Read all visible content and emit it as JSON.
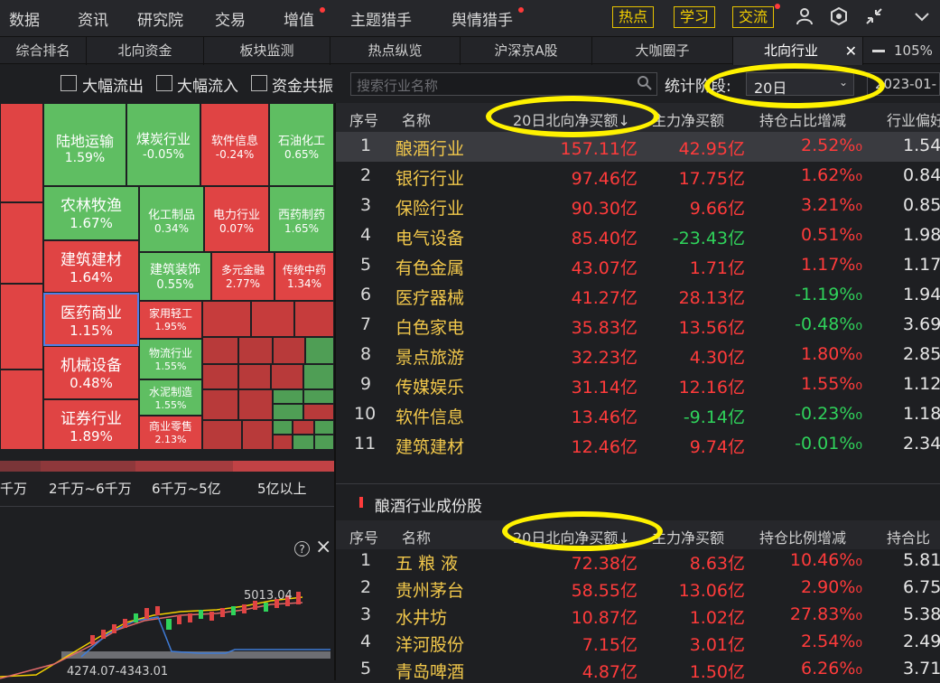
{
  "topnav": {
    "items": [
      "数据",
      "资讯",
      "研究院",
      "交易",
      "增值",
      "主题猎手",
      "舆情猎手"
    ],
    "boxes": [
      "热点",
      "学习",
      "交流"
    ]
  },
  "tabs": [
    "综合排名",
    "北向资金",
    "板块监测",
    "热点纵览",
    "沪深京A股",
    "大咖圈子",
    "北向行业"
  ],
  "zoom": "105%",
  "filters": {
    "checkboxes": [
      "大幅流出",
      "大幅流入",
      "资金共振"
    ],
    "search_placeholder": "搜索行业名称",
    "period_label": "统计阶段:",
    "period_value": "20日",
    "date_value": "2023-01-"
  },
  "treemap": {
    "cells": [
      {
        "name": "陆地运输",
        "pct": "1.59%"
      },
      {
        "name": "煤炭行业",
        "pct": "-0.05%"
      },
      {
        "name": "软件信息",
        "pct": "-0.24%"
      },
      {
        "name": "石油化工",
        "pct": "0.65%"
      },
      {
        "name": "农林牧渔",
        "pct": "1.67%"
      },
      {
        "name": "化工制品",
        "pct": "0.34%"
      },
      {
        "name": "电力行业",
        "pct": "0.07%"
      },
      {
        "name": "西药制药",
        "pct": "1.65%"
      },
      {
        "name": "建筑建材",
        "pct": "1.64%"
      },
      {
        "name": "建筑装饰",
        "pct": "0.55%"
      },
      {
        "name": "多元金融",
        "pct": "2.77%"
      },
      {
        "name": "传统中药",
        "pct": "1.34%"
      },
      {
        "name": "医药商业",
        "pct": "1.15%"
      },
      {
        "name": "家用轻工",
        "pct": "1.95%"
      },
      {
        "name": "机械设备",
        "pct": "0.48%"
      },
      {
        "name": "物流行业",
        "pct": "1.55%"
      },
      {
        "name": "水泥制造",
        "pct": "1.55%"
      },
      {
        "name": "证券行业",
        "pct": "1.89%"
      },
      {
        "name": "商业零售",
        "pct": "2.13%"
      }
    ],
    "legend": [
      "千万",
      "2千万~6千万",
      "6千万~5亿",
      "5亿以上"
    ]
  },
  "mini_chart": {
    "help_icon": "?",
    "close_icon": "×",
    "high_label": "5013.04",
    "range_label": "4274.07-4343.01"
  },
  "industry_table": {
    "headers": [
      "序号",
      "名称",
      "20日北向净买额↓",
      "主力净买额",
      "持仓占比增减",
      "行业偏好"
    ],
    "rows": [
      {
        "idx": "1",
        "name": "酿酒行业",
        "north": "157.11亿",
        "main": "42.95亿",
        "chg": "2.52%₀",
        "pref": "1.54"
      },
      {
        "idx": "2",
        "name": "银行行业",
        "north": "97.46亿",
        "main": "17.75亿",
        "chg": "1.62%₀",
        "pref": "0.84"
      },
      {
        "idx": "3",
        "name": "保险行业",
        "north": "90.30亿",
        "main": "9.66亿",
        "chg": "3.21%₀",
        "pref": "0.85"
      },
      {
        "idx": "4",
        "name": "电气设备",
        "north": "85.40亿",
        "main": "-23.43亿",
        "chg": "0.51%₀",
        "pref": "1.98"
      },
      {
        "idx": "5",
        "name": "有色金属",
        "north": "43.07亿",
        "main": "1.71亿",
        "chg": "1.17%₀",
        "pref": "1.17"
      },
      {
        "idx": "6",
        "name": "医疗器械",
        "north": "41.27亿",
        "main": "28.13亿",
        "chg": "-1.19%₀",
        "pref": "1.94"
      },
      {
        "idx": "7",
        "name": "白色家电",
        "north": "35.83亿",
        "main": "13.56亿",
        "chg": "-0.48%₀",
        "pref": "3.69"
      },
      {
        "idx": "8",
        "name": "景点旅游",
        "north": "32.23亿",
        "main": "4.30亿",
        "chg": "1.80%₀",
        "pref": "2.85"
      },
      {
        "idx": "9",
        "name": "传媒娱乐",
        "north": "31.14亿",
        "main": "12.16亿",
        "chg": "1.55%₀",
        "pref": "1.12"
      },
      {
        "idx": "10",
        "name": "软件信息",
        "north": "13.46亿",
        "main": "-9.14亿",
        "chg": "-0.23%₀",
        "pref": "1.18"
      },
      {
        "idx": "11",
        "name": "建筑建材",
        "north": "12.46亿",
        "main": "9.74亿",
        "chg": "-0.01%₀",
        "pref": "2.34"
      }
    ]
  },
  "stock_section": {
    "title": "酿酒行业成份股",
    "headers": [
      "序号",
      "名称",
      "20日北向净买额↓",
      "主力净买额",
      "持仓比例增减",
      "持合比"
    ],
    "rows": [
      {
        "idx": "1",
        "name": "五 粮 液",
        "north": "72.38亿",
        "main": "8.63亿",
        "chg": "10.46%₀",
        "last": "5.81"
      },
      {
        "idx": "2",
        "name": "贵州茅台",
        "north": "58.55亿",
        "main": "13.06亿",
        "chg": "2.90%₀",
        "last": "6.75"
      },
      {
        "idx": "3",
        "name": "水井坊",
        "north": "10.87亿",
        "main": "1.02亿",
        "chg": "27.83%₀",
        "last": "5.38"
      },
      {
        "idx": "4",
        "name": "洋河股份",
        "north": "7.15亿",
        "main": "3.01亿",
        "chg": "2.54%₀",
        "last": "2.49"
      },
      {
        "idx": "5",
        "name": "青岛啤酒",
        "north": "4.87亿",
        "main": "1.50亿",
        "chg": "6.26%₀",
        "last": "3.71"
      }
    ]
  },
  "chart_data": {
    "type": "table",
    "title": "北向行业",
    "columns": [
      "序号",
      "名称",
      "20日北向净买额",
      "主力净买额",
      "持仓占比增减",
      "行业偏好"
    ],
    "rows": [
      [
        "1",
        "酿酒行业",
        "157.11亿",
        "42.95亿",
        "2.52%₀",
        "1.54"
      ],
      [
        "2",
        "银行行业",
        "97.46亿",
        "17.75亿",
        "1.62%₀",
        "0.84"
      ],
      [
        "3",
        "保险行业",
        "90.30亿",
        "9.66亿",
        "3.21%₀",
        "0.85"
      ],
      [
        "4",
        "电气设备",
        "85.40亿",
        "-23.43亿",
        "0.51%₀",
        "1.98"
      ],
      [
        "5",
        "有色金属",
        "43.07亿",
        "1.71亿",
        "1.17%₀",
        "1.17"
      ],
      [
        "6",
        "医疗器械",
        "41.27亿",
        "28.13亿",
        "-1.19%₀",
        "1.94"
      ],
      [
        "7",
        "白色家电",
        "35.83亿",
        "13.56亿",
        "-0.48%₀",
        "3.69"
      ],
      [
        "8",
        "景点旅游",
        "32.23亿",
        "4.30亿",
        "1.80%₀",
        "2.85"
      ],
      [
        "9",
        "传媒娱乐",
        "31.14亿",
        "12.16亿",
        "1.55%₀",
        "1.12"
      ],
      [
        "10",
        "软件信息",
        "13.46亿",
        "-9.14亿",
        "-0.23%₀",
        "1.18"
      ],
      [
        "11",
        "建筑建材",
        "12.46亿",
        "9.74亿",
        "-0.01%₀",
        "2.34"
      ]
    ]
  },
  "colors": {
    "up": "#ff3b3b",
    "down": "#2fd35b",
    "name_gold": "#f2c84b",
    "treemap_red": "#e04444",
    "treemap_green": "#5fbe62",
    "highlight_yellow": "#fff200"
  }
}
